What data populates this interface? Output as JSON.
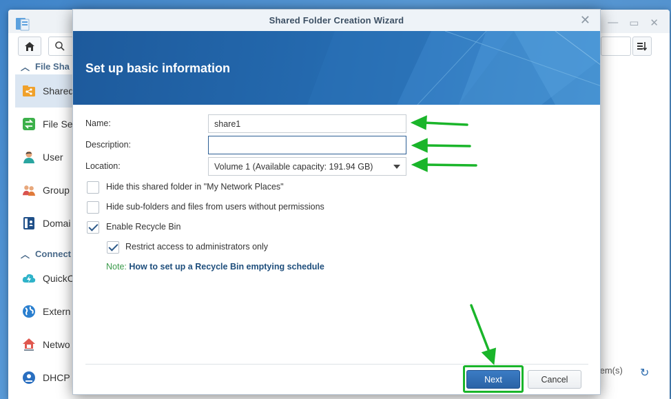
{
  "background_window": {
    "sidebar": {
      "sections": [
        {
          "label": "File Sharing",
          "visible": "File Sha"
        },
        {
          "label": "Connectivity",
          "visible": "Connect"
        }
      ],
      "items": [
        {
          "label": "Shared",
          "icon": "shared-folder-icon",
          "active": true
        },
        {
          "label": "File Se",
          "icon": "file-services-icon"
        },
        {
          "label": "User",
          "icon": "user-icon"
        },
        {
          "label": "Group",
          "icon": "group-icon"
        },
        {
          "label": "Domai",
          "icon": "domain-icon"
        },
        {
          "label": "QuickC",
          "icon": "quickconnect-icon"
        },
        {
          "label": "Extern",
          "icon": "external-access-icon"
        },
        {
          "label": "Netwo",
          "icon": "network-icon"
        },
        {
          "label": "DHCP S",
          "icon": "dhcp-icon"
        }
      ]
    },
    "status": "tem(s)"
  },
  "dialog": {
    "title": "Shared Folder Creation Wizard",
    "banner_title": "Set up basic information",
    "fields": {
      "name_label": "Name:",
      "name_value": "share1",
      "description_label": "Description:",
      "description_value": "",
      "location_label": "Location:",
      "location_value": "Volume 1 (Available capacity:  191.94 GB)"
    },
    "checkboxes": [
      {
        "label": "Hide this shared folder in \"My Network Places\"",
        "checked": false
      },
      {
        "label": "Hide sub-folders and files from users without permissions",
        "checked": false
      },
      {
        "label": "Enable Recycle Bin",
        "checked": true
      },
      {
        "label": "Restrict access to administrators only",
        "checked": true
      }
    ],
    "note_prefix": "Note:",
    "note_link": "How to set up a Recycle Bin emptying schedule",
    "buttons": {
      "next": "Next",
      "cancel": "Cancel"
    }
  },
  "colors": {
    "accent": "#2a63a6",
    "annotation": "#1ab52a"
  }
}
